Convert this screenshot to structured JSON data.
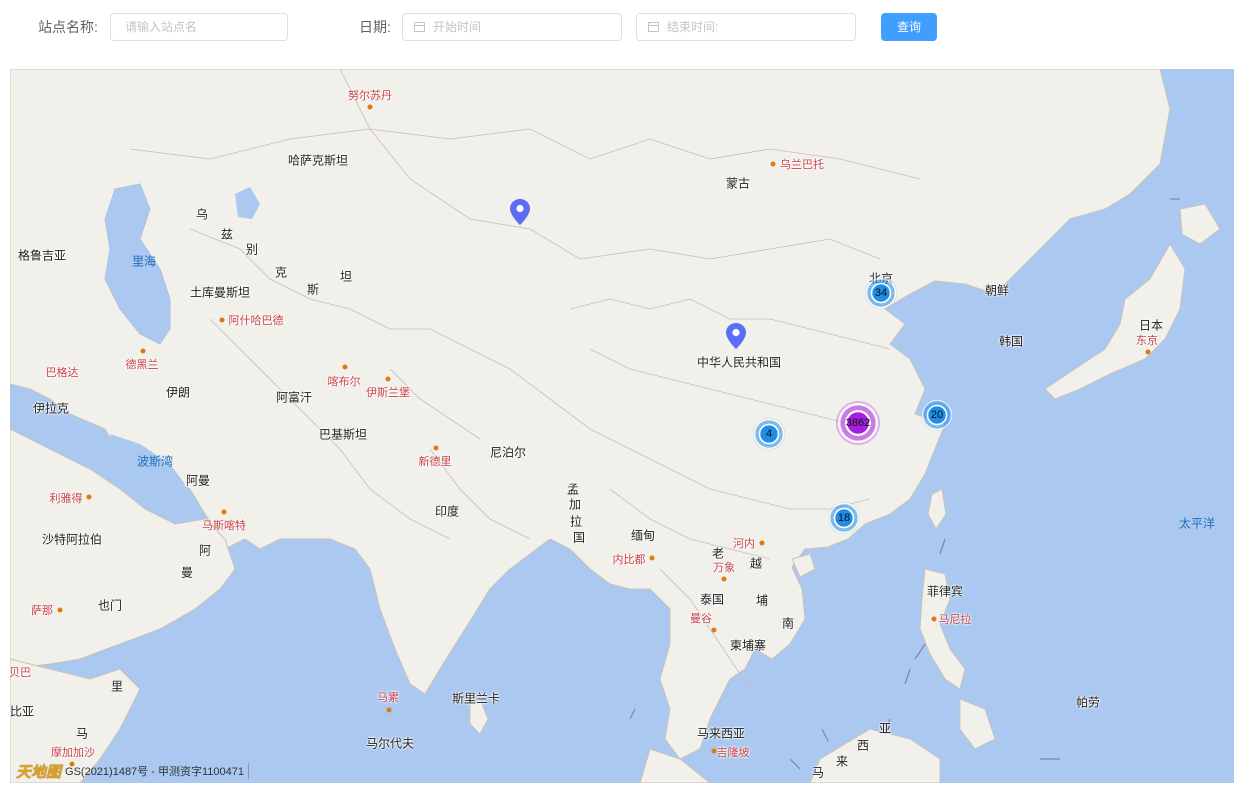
{
  "search": {
    "station_label": "站点名称:",
    "station_placeholder": "请输入站点名",
    "date_label": "日期:",
    "start_placeholder": "开始时间",
    "end_placeholder": "结束时间:",
    "query_button": "查询"
  },
  "map": {
    "labels": {
      "kazakhstan": "哈萨克斯坦",
      "mongolia": "蒙古",
      "ulaanbaatar": "乌兰巴托",
      "novosibirsk": "努尔苏丹",
      "uzbek_1": "乌",
      "uzbek_2": "兹",
      "uzbek_3": "别",
      "uzbek_4": "克",
      "uzbek_5": "斯",
      "uzbek_6": "坦",
      "georgia": "格鲁吉亚",
      "caspian": "里海",
      "turkmenistan": "土库曼斯坦",
      "ashgabat": "阿什哈巴德",
      "baghdad": "巴格达",
      "tehran": "德黑兰",
      "iran": "伊朗",
      "iraq": "伊拉克",
      "afghanistan": "阿富汗",
      "kabul": "喀布尔",
      "islamabad": "伊斯兰堡",
      "pakistan": "巴基斯坦",
      "persian_gulf": "波斯湾",
      "new_delhi": "新德里",
      "nepal": "尼泊尔",
      "oman_short": "阿曼",
      "riyadh": "利雅得",
      "muscat": "马斯喀特",
      "saudi": "沙特阿拉伯",
      "oman_1": "阿",
      "oman_2": "曼",
      "sanaa": "萨那",
      "yemen": "也门",
      "india": "印度",
      "bangladesh_1": "孟",
      "bangladesh_2": "加",
      "bangladesh_3": "拉",
      "bangladesh_4": "国",
      "myanmar": "缅甸",
      "naypyidaw": "内比都",
      "laos_1": "老",
      "vientiane": "万象",
      "vietnam_1": "越",
      "vietnam_2": "南",
      "hanoi": "河内",
      "thailand": "泰国",
      "bangkok": "曼谷",
      "cambodia_1": "柬",
      "cambodia_2": "埔",
      "cambodia_3": "寨",
      "cambodia": "柬埔寨",
      "china": "中华人民共和国",
      "beijing": "北京",
      "north_korea": "朝鲜",
      "south_korea": "韩国",
      "japan": "日本",
      "tokyo": "东京",
      "pacific": "太平洋",
      "philippines": "菲律宾",
      "manila": "马尼拉",
      "sri_lanka": "斯里兰卡",
      "male": "马累",
      "maldives": "马尔代夫",
      "malaysia": "马来西亚",
      "kuala_lumpur": "吉隆坡",
      "palau": "帕劳",
      "somalia_1": "里",
      "somalia_2": "马",
      "mogadishu": "摩加加沙",
      "somalia_3": "比亚",
      "djibouti": "贝巴",
      "indonesia_1": "亚",
      "indonesia_2": "西",
      "indonesia_3": "来",
      "indonesia_4": "马",
      "indonesia_5": "亚"
    },
    "clusters": [
      {
        "count": "34",
        "style": "blue"
      },
      {
        "count": "20",
        "style": "blue"
      },
      {
        "count": "3862",
        "style": "purple"
      },
      {
        "count": "4",
        "style": "blue"
      },
      {
        "count": "18",
        "style": "blue"
      }
    ],
    "license": "GS(2021)1487号 - 甲测资字1100471",
    "logo": "天地图",
    "colors": {
      "marker": "#5b6ef5",
      "cluster_blue": "#1e8ee8",
      "cluster_purple": "#a61fe0",
      "sea": "#abc8f0",
      "land": "#f2f0eb"
    }
  }
}
